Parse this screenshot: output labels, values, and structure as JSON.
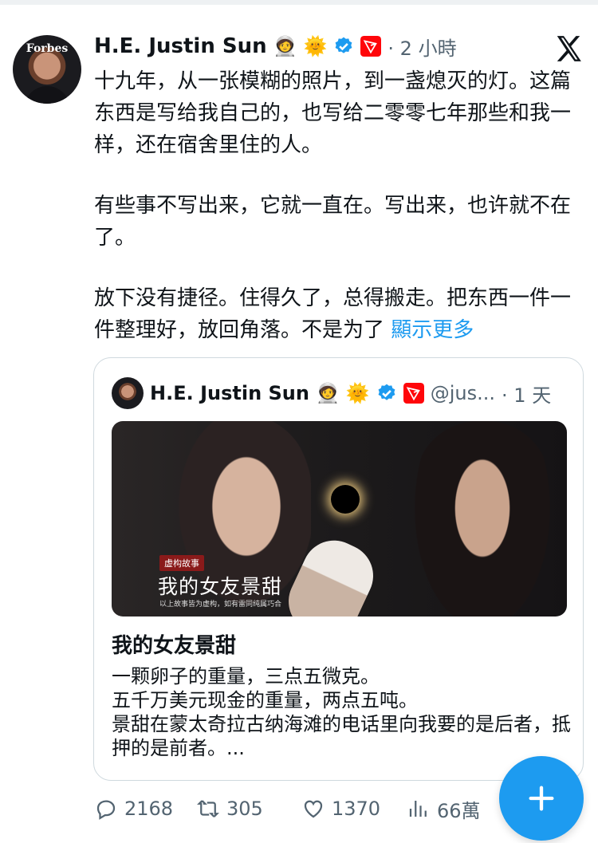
{
  "tweet": {
    "author": "H.E. Justin Sun",
    "avatar_text": "Forbes",
    "emojis": [
      "🧑‍🚀",
      "🌞"
    ],
    "time": "· 2 小時",
    "paragraphs": [
      "十九年，从一张模糊的照片，到一盏熄灭的灯。这篇东西是写给我自己的，也写给二零零七年那些和我一样，还在宿舍里住的人。",
      "有些事不写出来，它就一直在。写出来，也许就不在了。"
    ],
    "truncated": "放下没有捷径。住得久了，总得搬走。把东西一件一件整理好，放回角落。不是为了",
    "show_more": "顯示更多"
  },
  "quote": {
    "author": "H.E. Justin Sun",
    "handle": "@jus...",
    "time": "· 1 天",
    "image": {
      "tag": "虚构故事",
      "title": "我的女友景甜",
      "disclaimer": "以上故事皆为虚构，如有雷同纯属巧合"
    },
    "title": "我的女友景甜",
    "lines": [
      "一颗卵子的重量，三点五微克。",
      "五千万美元现金的重量，两点五吨。",
      "景甜在蒙太奇拉古纳海滩的电话里向我要的是后者，抵押的是前者。..."
    ]
  },
  "actions": {
    "replies": "2168",
    "retweets": "305",
    "likes": "1370",
    "views": "66萬"
  },
  "icons": {
    "verified": "verified-badge-icon",
    "tron": "tron-logo-icon",
    "x": "x-logo-icon",
    "compose": "plus-icon"
  },
  "colors": {
    "accent": "#1d9bf0",
    "tron_red": "#ff060a",
    "muted": "#536471"
  }
}
